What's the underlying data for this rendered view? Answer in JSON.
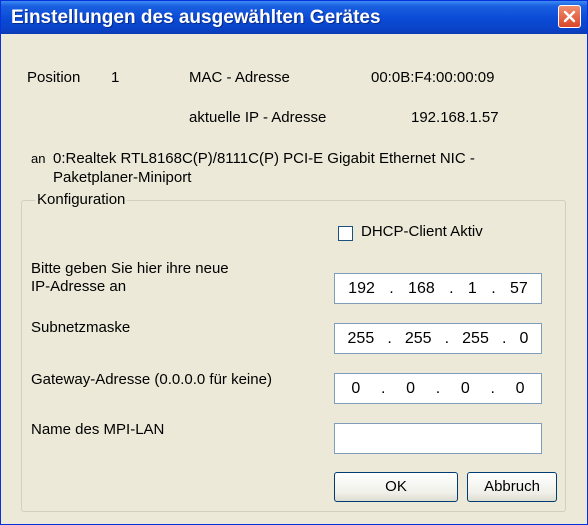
{
  "window": {
    "title": "Einstellungen des ausgewählten Gerätes"
  },
  "info": {
    "position_label": "Position",
    "position_value": "1",
    "mac_label": "MAC - Adresse",
    "mac_value": "00:0B:F4:00:00:09",
    "ip_label": "aktuelle IP - Adresse",
    "ip_value": "192.168.1.57",
    "an_label": "an",
    "adapter_line1": "0:Realtek RTL8168C(P)/8111C(P) PCI-E Gigabit Ethernet NIC -",
    "adapter_line2": "Paketplaner-Miniport"
  },
  "config": {
    "group_label": "Konfiguration",
    "dhcp_label": "DHCP-Client Aktiv",
    "dhcp_checked": false,
    "ip_label_line1": "Bitte geben Sie hier ihre neue",
    "ip_label_line2": "IP-Adresse an",
    "ip_octets": [
      "192",
      "168",
      "1",
      "57"
    ],
    "subnet_label": "Subnetzmaske",
    "subnet_octets": [
      "255",
      "255",
      "255",
      "0"
    ],
    "gateway_label": "Gateway-Adresse (0.0.0.0 für keine)",
    "gateway_octets": [
      "0",
      "0",
      "0",
      "0"
    ],
    "mpi_label": "Name des MPI-LAN",
    "mpi_value": ""
  },
  "buttons": {
    "ok": "OK",
    "cancel": "Abbruch"
  },
  "colors": {
    "titlebar": "#0a4ad6",
    "close": "#d9462a",
    "background": "#ece9d8"
  },
  "icons": {
    "close": "close-icon"
  }
}
